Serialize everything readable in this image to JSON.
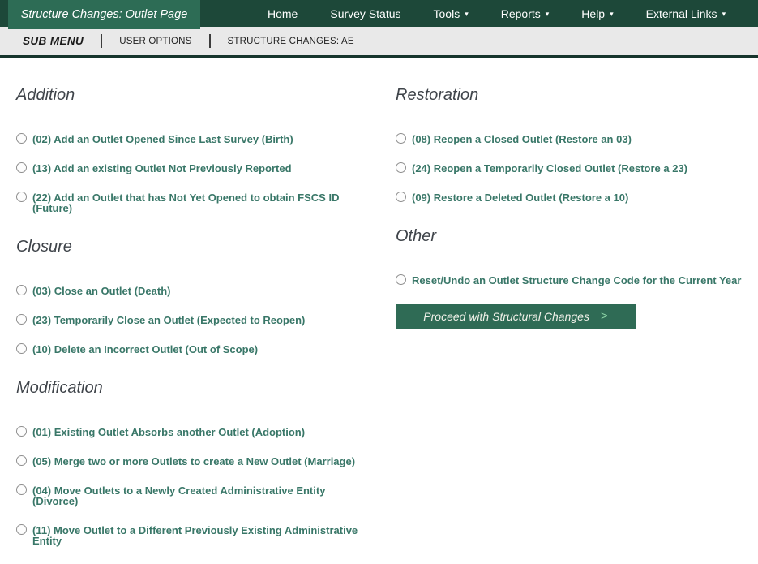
{
  "header": {
    "title_tab": "Structure Changes: Outlet Page",
    "nav": [
      {
        "label": "Home",
        "dropdown": false
      },
      {
        "label": "Survey Status",
        "dropdown": false
      },
      {
        "label": "Tools",
        "dropdown": true
      },
      {
        "label": "Reports",
        "dropdown": true
      },
      {
        "label": "Help",
        "dropdown": true
      },
      {
        "label": "External Links",
        "dropdown": true
      }
    ]
  },
  "submenu": {
    "items": [
      "SUB MENU",
      "USER OPTIONS",
      "STRUCTURE CHANGES: AE"
    ]
  },
  "sections": {
    "left": [
      {
        "heading": "Addition",
        "options": [
          {
            "lines": [
              "(02) Add an Outlet Opened Since Last Survey (Birth)"
            ]
          },
          {
            "lines": [
              "(13) Add an existing Outlet Not Previously Reported"
            ]
          },
          {
            "lines": [
              "(22) Add an Outlet that has Not Yet Opened to obtain FSCS ID",
              "(Future)"
            ]
          }
        ]
      },
      {
        "heading": "Closure",
        "options": [
          {
            "lines": [
              "(03) Close an Outlet (Death)"
            ]
          },
          {
            "lines": [
              "(23) Temporarily Close an Outlet (Expected to Reopen)"
            ]
          },
          {
            "lines": [
              "(10) Delete an Incorrect Outlet (Out of Scope)"
            ]
          }
        ]
      },
      {
        "heading": "Modification",
        "options": [
          {
            "lines": [
              "(01) Existing Outlet Absorbs another Outlet (Adoption)"
            ]
          },
          {
            "lines": [
              "(05) Merge two or more Outlets to create a New Outlet (Marriage)"
            ]
          },
          {
            "lines": [
              "(04) Move Outlets to a Newly Created Administrative Entity",
              "(Divorce)"
            ]
          },
          {
            "lines": [
              "(11) Move Outlet to a Different Previously Existing Administrative",
              "Entity"
            ]
          }
        ]
      }
    ],
    "right": [
      {
        "heading": "Restoration",
        "options": [
          {
            "lines": [
              "(08) Reopen a Closed Outlet (Restore an 03)"
            ]
          },
          {
            "lines": [
              "(24) Reopen a Temporarily Closed Outlet (Restore a 23)"
            ]
          },
          {
            "lines": [
              "(09) Restore a Deleted Outlet (Restore a 10)"
            ]
          }
        ]
      },
      {
        "heading": "Other",
        "options": [
          {
            "lines": [
              "Reset/Undo an Outlet Structure Change Code for the Current Year"
            ]
          }
        ]
      }
    ]
  },
  "proceed_button": {
    "label": "Proceed with Structural Changes"
  },
  "icons": {
    "caret_down": "▾",
    "chevron_right": ">"
  },
  "colors": {
    "header_green": "#1d4839",
    "tab_green": "#2d6c55",
    "submenu_bg": "#e9e9e9",
    "submenu_border": "#16352c",
    "option_teal": "#397768",
    "heading_gray": "#3f444a",
    "button_green": "#2f6b55",
    "button_chevron_green": "#8bd3a5"
  }
}
